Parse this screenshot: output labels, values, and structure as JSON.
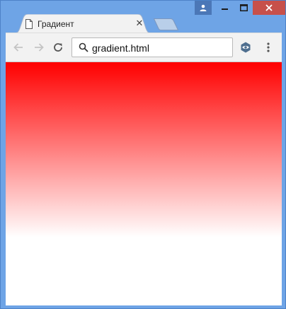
{
  "window": {
    "frame_color": "#6ea4e6",
    "controls": {
      "profile_icon": "user-icon",
      "minimize_icon": "minimize-icon",
      "maximize_icon": "maximize-icon",
      "close_icon": "close-icon",
      "close_color": "#c7504a"
    }
  },
  "tabs": [
    {
      "title": "Градиент",
      "icon": "document-icon",
      "close_glyph": "✕",
      "active": true
    }
  ],
  "toolbar": {
    "back_icon": "arrow-left-icon",
    "forward_icon": "arrow-right-icon",
    "reload_icon": "reload-icon",
    "url": "gradient.html",
    "search_icon": "search-icon",
    "extension_icon": "eye-icon",
    "menu_icon": "kebab-menu-icon"
  },
  "page": {
    "gradient": {
      "direction": "to bottom",
      "start_color": "#ff0000",
      "end_color": "#ffffff"
    }
  }
}
